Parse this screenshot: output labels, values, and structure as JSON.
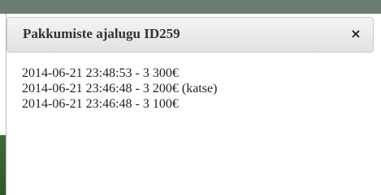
{
  "dialog": {
    "title": "Pakkumiste ajalugu ID259",
    "close_label": "×"
  },
  "history": [
    "2014-06-21 23:48:53 - 3 300€",
    "2014-06-21 23:46:48 - 3 200€ (katse)",
    "2014-06-21 23:46:48 - 3 100€"
  ]
}
